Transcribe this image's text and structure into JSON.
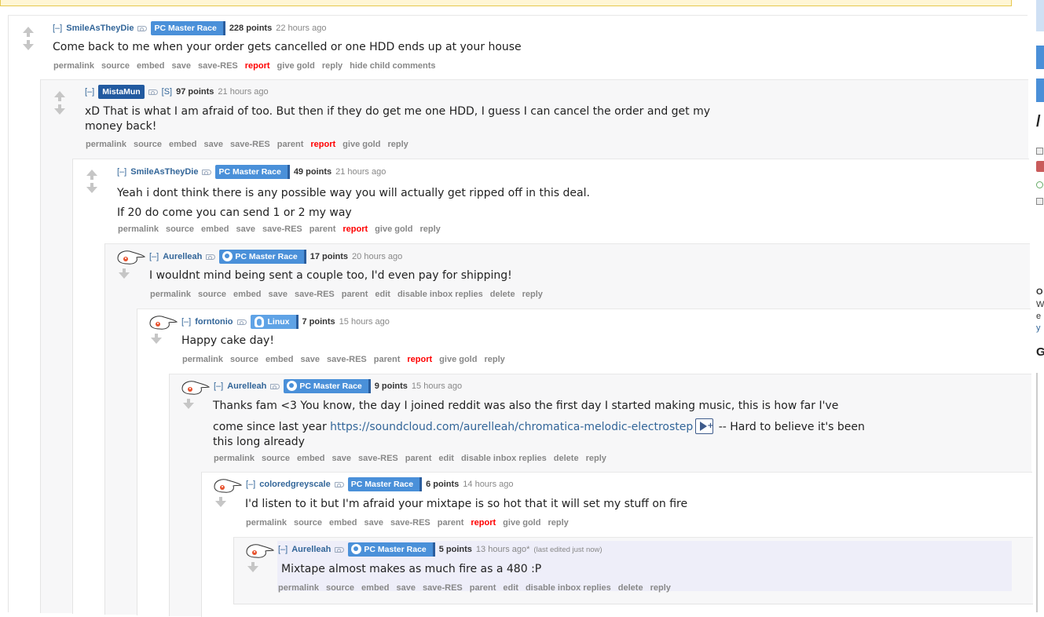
{
  "sidebar_fragments": {
    "slash": "/",
    "o": "O",
    "w": "W",
    "e": "e",
    "y": "y",
    "g": "G"
  },
  "action_labels": {
    "permalink": "permalink",
    "source": "source",
    "embed": "embed",
    "save": "save",
    "save_res": "save-RES",
    "parent": "parent",
    "edit": "edit",
    "report": "report",
    "give_gold": "give gold",
    "reply": "reply",
    "hide_child": "hide child comments",
    "disable_inbox": "disable inbox replies",
    "delete": "delete"
  },
  "comments": [
    {
      "collapse": "[–]",
      "author": "SmileAsTheyDie",
      "flair": "PC Master Race",
      "score": "228 points",
      "time": "22 hours ago",
      "body": [
        "Come back to me when your order gets cancelled or one HDD ends up at your house"
      ]
    },
    {
      "collapse": "[–]",
      "author": "MistaMun",
      "submitter": "[S]",
      "score": "97 points",
      "time": "21 hours ago",
      "body": [
        "xD That is what I am afraid of too. But then if they do get me one HDD, I guess I can cancel the order and get my",
        "money back!"
      ]
    },
    {
      "collapse": "[–]",
      "author": "SmileAsTheyDie",
      "flair": "PC Master Race",
      "score": "49 points",
      "time": "21 hours ago",
      "body": [
        "Yeah i dont think there is any possible way you will actually get ripped off in this deal.",
        "If 20 do come you can send 1 or 2 my way"
      ]
    },
    {
      "collapse": "[–]",
      "author": "Aurelleah",
      "flair": "PC Master Race",
      "score": "17 points",
      "time": "20 hours ago",
      "body": [
        "I wouldnt mind being sent a couple too, I'd even pay for shipping!"
      ]
    },
    {
      "collapse": "[–]",
      "author": "forntonio",
      "flair": "Linux",
      "score": "7 points",
      "time": "15 hours ago",
      "body": [
        "Happy cake day!"
      ]
    },
    {
      "collapse": "[–]",
      "author": "Aurelleah",
      "flair": "PC Master Race",
      "score": "9 points",
      "time": "15 hours ago",
      "body_line1": "Thanks fam <3 You know, the day I joined reddit was also the first day I started making music, this is how far I've",
      "body_line2_pre": "come since last year ",
      "link": "https://soundcloud.com/aurelleah/chromatica-melodic-electrostep",
      "body_line2_post": " -- Hard to believe it's been",
      "body_line3": "this long already"
    },
    {
      "collapse": "[–]",
      "author": "coloredgreyscale",
      "flair": "PC Master Race",
      "score": "6 points",
      "time": "14 hours ago",
      "body": [
        "I'd listen to it but I'm afraid your mixtape is so hot that it will set my stuff on fire"
      ]
    },
    {
      "collapse": "[–]",
      "author": "Aurelleah",
      "flair": "PC Master Race",
      "score": "5 points",
      "time": "13 hours ago*",
      "edited": "(last edited just now)",
      "body": [
        "Mixtape almost makes as much fire as a 480 :P"
      ]
    }
  ]
}
